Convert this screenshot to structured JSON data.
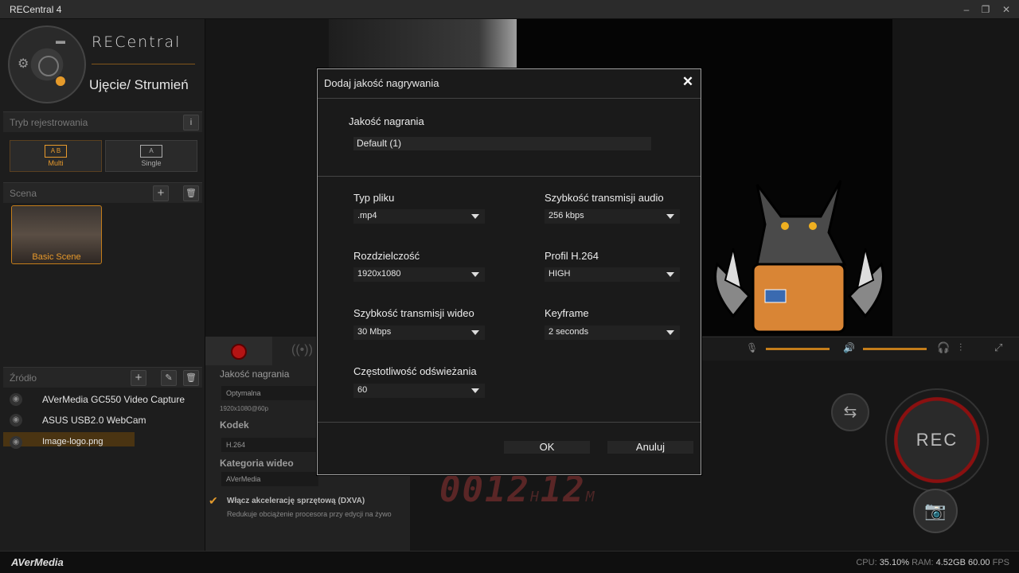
{
  "window": {
    "title": "RECentral 4",
    "minimize": "–",
    "restore": "❐",
    "close": "✕"
  },
  "brand": {
    "name": "RECentral",
    "mode": "Ujęcie/ Strumień"
  },
  "record_mode": {
    "header": "Tryb rejestrowania",
    "info": "i",
    "multi": "Multi",
    "single": "Single"
  },
  "scene": {
    "header": "Scena",
    "add": "+",
    "delete": "🗑",
    "items": [
      {
        "label": "Basic Scene"
      }
    ]
  },
  "source": {
    "header": "Źródło",
    "add": "+",
    "edit": "✎",
    "delete": "🗑",
    "items": [
      {
        "label": "AVerMedia GC550 Video Capture"
      },
      {
        "label": "ASUS USB2.0 WebCam"
      },
      {
        "label": "Image-logo.png"
      }
    ]
  },
  "rec_panel": {
    "quality_label": "Jakość nagrania",
    "quality_value": "Optymalna",
    "quality_sub": "1920x1080@60p",
    "codec_label": "Kodek",
    "codec_value": "H.264",
    "category_label": "Kategoria wideo",
    "category_value": "AVerMedia",
    "hw_accel_label": "Włącz akcelerację sprzętową (DXVA)",
    "hw_accel_desc": "Redukuje obciążenie procesora przy edycji na żywo"
  },
  "timer": {
    "hours": "0012",
    "h_unit": "H",
    "minutes": "12",
    "m_unit": "M"
  },
  "rec_button": {
    "label": "REC"
  },
  "status": {
    "brand": "AVerMedia",
    "cpu_label": "CPU:",
    "cpu": "35.10%",
    "ram_label": "RAM:",
    "ram": "4.52GB",
    "fps": "60.00",
    "fps_label": "FPS"
  },
  "dialog": {
    "title": "Dodaj jakość nagrywania",
    "close": "✕",
    "quality_label": "Jakość nagrania",
    "quality_value": "Default (1)",
    "file_type_label": "Typ pliku",
    "file_type_value": ".mp4",
    "audio_bitrate_label": "Szybkość transmisji audio",
    "audio_bitrate_value": "256 kbps",
    "resolution_label": "Rozdzielczość",
    "resolution_value": "1920x1080",
    "profile_label": "Profil H.264",
    "profile_value": "HIGH",
    "video_bitrate_label": "Szybkość transmisji wideo",
    "video_bitrate_value": "30 Mbps",
    "keyframe_label": "Keyframe",
    "keyframe_value": "2 seconds",
    "framerate_label": "Częstotliwość odświeżania",
    "framerate_value": "60",
    "ok": "OK",
    "cancel": "Anuluj"
  },
  "colors": {
    "accent": "#c47d1a",
    "rec": "#b41414"
  }
}
